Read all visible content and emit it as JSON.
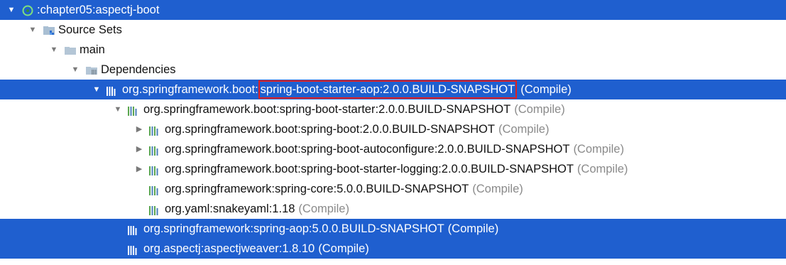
{
  "project": {
    "label": ":chapter05:aspectj-boot",
    "icon": "gradle-module-icon"
  },
  "source_sets": {
    "label": "Source Sets",
    "icon": "source-sets-folder-icon"
  },
  "main": {
    "label": "main",
    "icon": "folder-icon"
  },
  "dependencies": {
    "label": "Dependencies",
    "icon": "library-folder-icon"
  },
  "deps": [
    {
      "prefix": "org.springframework.boot:",
      "highlight": "spring-boot-starter-aop:2.0.0.BUILD-SNAPSHOT",
      "scope": "(Compile)",
      "selected": true,
      "expanded": true
    },
    {
      "label": "org.springframework.boot:spring-boot-starter:2.0.0.BUILD-SNAPSHOT",
      "scope": "(Compile)",
      "selected": false,
      "expanded": true
    },
    {
      "label": "org.springframework.boot:spring-boot:2.0.0.BUILD-SNAPSHOT",
      "scope": "(Compile)",
      "selected": false,
      "expanded": false
    },
    {
      "label": "org.springframework.boot:spring-boot-autoconfigure:2.0.0.BUILD-SNAPSHOT",
      "scope": "(Compile)",
      "selected": false,
      "expanded": false
    },
    {
      "label": "org.springframework.boot:spring-boot-starter-logging:2.0.0.BUILD-SNAPSHOT",
      "scope": "(Compile)",
      "selected": false,
      "expanded": false
    },
    {
      "label": "org.springframework:spring-core:5.0.0.BUILD-SNAPSHOT",
      "scope": "(Compile)",
      "selected": false,
      "leaf": true
    },
    {
      "label": "org.yaml:snakeyaml:1.18",
      "scope": "(Compile)",
      "selected": false,
      "leaf": true
    },
    {
      "label": "org.springframework:spring-aop:5.0.0.BUILD-SNAPSHOT",
      "scope": "(Compile)",
      "selected": true,
      "leaf": true
    },
    {
      "label": "org.aspectj:aspectjweaver:1.8.10",
      "scope": "(Compile)",
      "selected": true,
      "leaf": true
    }
  ],
  "colors": {
    "selection": "#1f5fcf",
    "highlight_box": "#e02020",
    "scope_text": "#8a8a8a",
    "arrow": "#7a7a7a"
  },
  "icons": {
    "expanded": "chevron-down-icon",
    "collapsed": "chevron-right-icon",
    "library": "library-jar-icon"
  }
}
